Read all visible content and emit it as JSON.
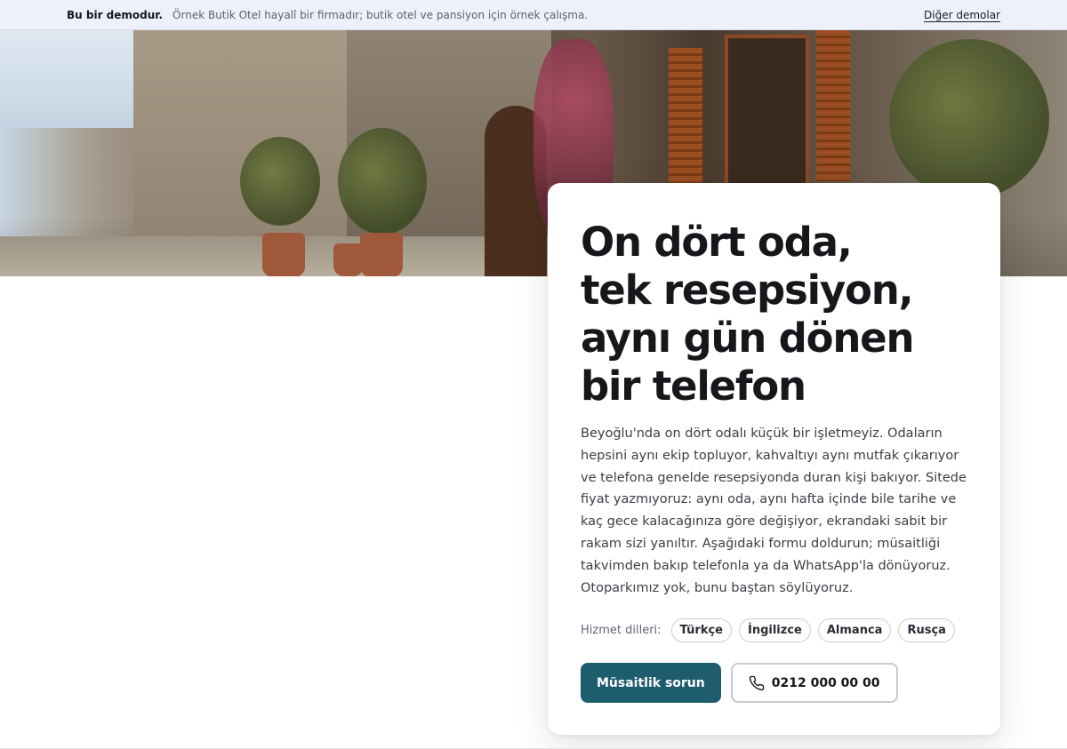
{
  "demo_bar": {
    "label": "Bu bir demodur.",
    "note": "Örnek Butik Otel hayalî bir firmadır; butik otel ve pansiyon için örnek çalışma.",
    "other_demos": "Diğer demolar"
  },
  "hero": {
    "headline_lines": [
      "On dört oda,",
      "tek resepsiyon,",
      "aynı gün dönen",
      "bir telefon"
    ],
    "body": "Beyoğlu'nda on dört odalı küçük bir işletmeyiz. Odaların hepsini aynı ekip topluyor, kahvaltıyı aynı mutfak çıkarıyor ve telefona genelde resepsiyonda duran kişi bakıyor. Sitede fiyat yazmıyoruz: aynı oda, aynı hafta içinde bile tarihe ve kaç gece kalacağınıza göre değişiyor, ekrandaki sabit bir rakam sizi yanıltır. Aşağıdaki formu doldurun; müsaitliği takvimden bakıp telefonla ya da WhatsApp'la dönüyoruz. Otoparkımız yok, bunu baştan söylüyoruz.",
    "languages_label": "Hizmet dilleri:",
    "languages": [
      "Türkçe",
      "İngilizce",
      "Almanca",
      "Rusça"
    ],
    "primary_cta": "Müsaitlik sorun",
    "phone_cta": "0212 000 00 00"
  },
  "colors": {
    "accent": "#1e5d6e",
    "demo_bar_bg": "#eef1fb"
  },
  "icons": {
    "phone": "phone-icon"
  }
}
